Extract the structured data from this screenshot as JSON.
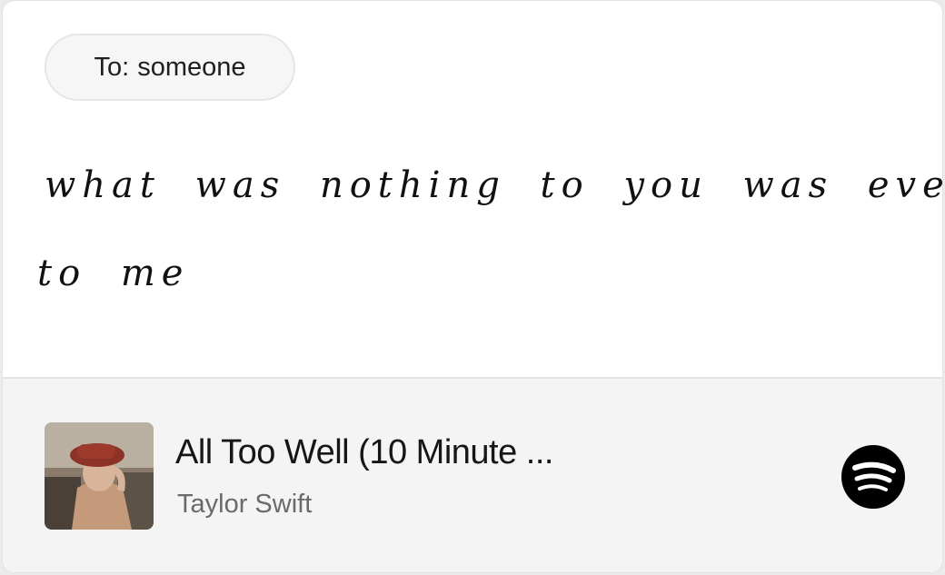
{
  "recipient": {
    "prefix": "To:",
    "name": "someone"
  },
  "message": {
    "lines": [
      "what was nothing to you was everything",
      "to me"
    ]
  },
  "track": {
    "title": "All Too Well (10 Minute ...",
    "artist": "Taylor Swift",
    "service_icon": "spotify-icon",
    "album_art": "album-cover"
  },
  "colors": {
    "card_bg": "#ffffff",
    "track_bar_bg": "#f4f4f5",
    "text_primary": "#161616",
    "text_secondary": "#6a6a6a",
    "spotify_icon": "#000000"
  }
}
